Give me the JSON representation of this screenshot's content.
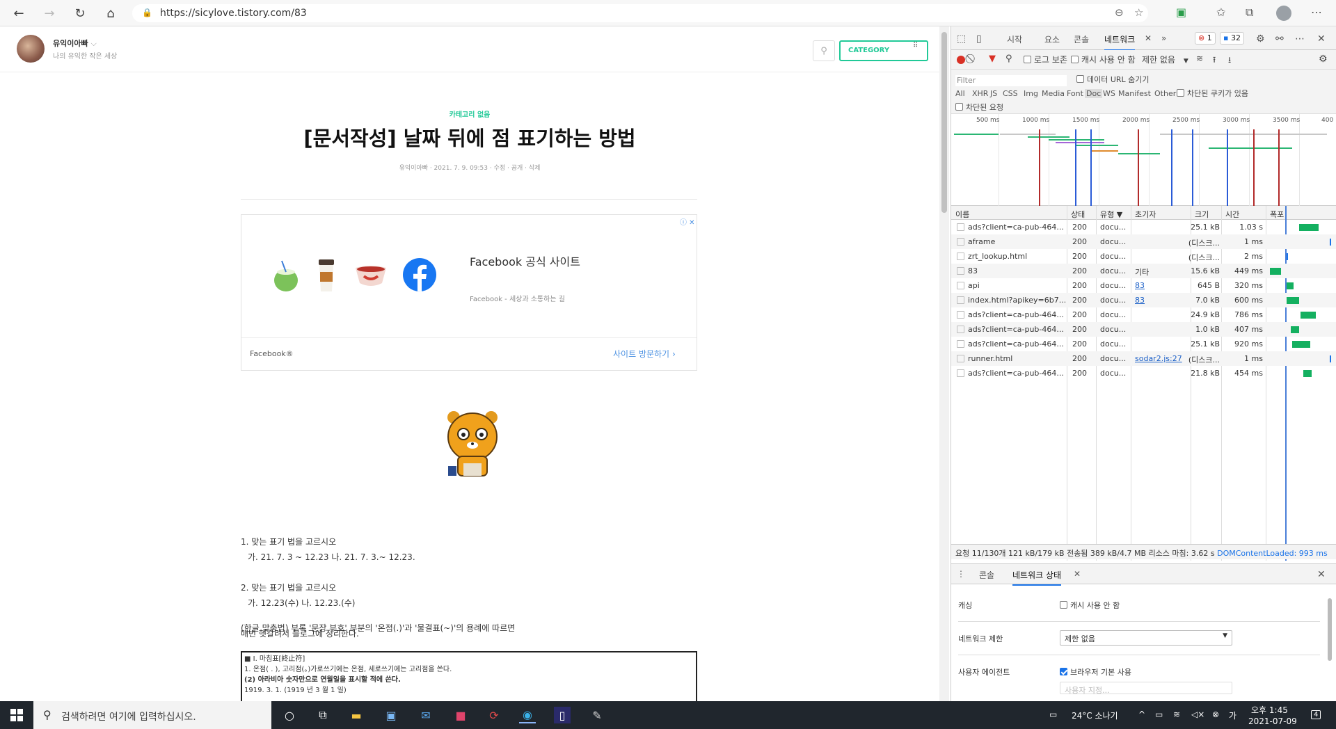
{
  "browser": {
    "url": "https://sicylove.tistory.com/83",
    "icons": [
      "back-icon",
      "forward-icon",
      "refresh-icon",
      "home-icon",
      "lock-icon",
      "zoom-out-icon",
      "star-add-icon",
      "extension-icon",
      "favorites-icon",
      "collections-icon",
      "profile-icon",
      "more-icon"
    ]
  },
  "blog": {
    "name": "유익이아빠",
    "description": "나의 유익한 작은 세상",
    "category_button": "CATEGORY"
  },
  "post": {
    "category": "카테고리 없음",
    "title": "[문서작성] 날짜 뒤에 점 표기하는 방법",
    "meta": "유익이아빠 · 2021. 7. 9. 09:53 · 수정 · 공개 · 삭제",
    "ad": {
      "title": "Facebook 공식 사이트",
      "description": "Facebook - 세상과 소통하는 길",
      "brand": "Facebook®",
      "cta": "사이트 방문하기"
    },
    "paragraphs": [
      "1. 맞는 표기 법을 고르시오",
      "가. 21. 7. 3 ~ 12.23    나. 21. 7. 3.~ 12.23.",
      "2. 맞는 표기 법을 고르시오",
      "가. 12.23(수)  나. 12.23.(수)",
      "매번 헷갈려서 블로그에 정리한다.",
      "(한글 맞춤법) 부록 '문장 부호' 부분의 '온점(.)'과 '물결표(~)'의 용례에 따르면"
    ],
    "quote_lines": [
      "■ Ⅰ. 마침표[終止符]",
      "1. 온점( . ), 고리점(。)가로쓰기에는 온점, 세로쓰기에는 고리점을 쓴다.",
      "(2) 아라비아 숫자만으로 연월일을 표시할 적에 쓴다.",
      "1919. 3. 1. (1919 년 3 월 1 일)"
    ]
  },
  "devtools": {
    "tabs": [
      "시작",
      "요소",
      "콘솔",
      "네트워크",
      "»"
    ],
    "active_tab": "네트워크",
    "error_count": "1",
    "message_count": "32",
    "toolbar": {
      "preserve_log": "로그 보존",
      "disable_cache": "캐시 사용 안 함",
      "throttle": "제한 없음"
    },
    "filter": {
      "placeholder": "Filter",
      "hide_data_urls": "데이터 URL 숨기기",
      "types": [
        "All",
        "XHR",
        "JS",
        "CSS",
        "Img",
        "Media",
        "Font",
        "Doc",
        "WS",
        "Manifest",
        "Other"
      ],
      "active_type": "Doc",
      "blocked_cookies": "차단된 쿠키가 있음",
      "blocked_requests": "차단된 요청"
    },
    "timeline_ticks": [
      "500 ms",
      "1000 ms",
      "1500 ms",
      "2000 ms",
      "2500 ms",
      "3000 ms",
      "3500 ms",
      "400"
    ],
    "columns": [
      "이름",
      "상태",
      "유형 ▼",
      "초기자",
      "크기",
      "시간",
      "폭포"
    ],
    "rows": [
      {
        "name": "ads?client=ca-pub-464...",
        "status": "200",
        "type": "docu...",
        "initiator": "",
        "initiator_link": false,
        "size": "25.1 kB",
        "time": "1.03 s"
      },
      {
        "name": "aframe",
        "status": "200",
        "type": "docu...",
        "initiator": "",
        "initiator_link": false,
        "size": "(디스크...",
        "time": "1 ms"
      },
      {
        "name": "zrt_lookup.html",
        "status": "200",
        "type": "docu...",
        "initiator": "",
        "initiator_link": false,
        "size": "(디스크...",
        "time": "2 ms"
      },
      {
        "name": "83",
        "status": "200",
        "type": "docu...",
        "initiator": "기타",
        "initiator_link": false,
        "size": "15.6 kB",
        "time": "449 ms"
      },
      {
        "name": "api",
        "status": "200",
        "type": "docu...",
        "initiator": "83",
        "initiator_link": true,
        "size": "645 B",
        "time": "320 ms"
      },
      {
        "name": "index.html?apikey=6b7...",
        "status": "200",
        "type": "docu...",
        "initiator": "83",
        "initiator_link": true,
        "size": "7.0 kB",
        "time": "600 ms"
      },
      {
        "name": "ads?client=ca-pub-464...",
        "status": "200",
        "type": "docu...",
        "initiator": "",
        "initiator_link": false,
        "size": "24.9 kB",
        "time": "786 ms"
      },
      {
        "name": "ads?client=ca-pub-464...",
        "status": "200",
        "type": "docu...",
        "initiator": "",
        "initiator_link": false,
        "size": "1.0 kB",
        "time": "407 ms"
      },
      {
        "name": "ads?client=ca-pub-464...",
        "status": "200",
        "type": "docu...",
        "initiator": "",
        "initiator_link": false,
        "size": "25.1 kB",
        "time": "920 ms"
      },
      {
        "name": "runner.html",
        "status": "200",
        "type": "docu...",
        "initiator": "sodar2.js:27",
        "initiator_link": true,
        "size": "(디스크...",
        "time": "1 ms"
      },
      {
        "name": "ads?client=ca-pub-464...",
        "status": "200",
        "type": "docu...",
        "initiator": "",
        "initiator_link": false,
        "size": "21.8 kB",
        "time": "454 ms"
      }
    ],
    "status_bar": "요청 11/130개  121 kB/179 kB 전송됨  389 kB/4.7 MB 리소스  마침: 3.62 s  ",
    "dom_content_loaded": "DOMContentLoaded: 993 ms",
    "drawer": {
      "tabs": [
        "콘솔",
        "네트워크 상태"
      ],
      "active_tab": "네트워크 상태",
      "cache_label": "캐싱",
      "cache_checkbox": "캐시 사용 안 함",
      "throttle_label": "네트워크 제한",
      "throttle_value": "제한 없음",
      "ua_label": "사용자 에이전트",
      "ua_checkbox": "브라우저 기본 사용",
      "ua_placeholder": "사용자 지정..."
    }
  },
  "taskbar": {
    "search_placeholder": "검색하려면 여기에 입력하십시오.",
    "weather": "24°C 소나기",
    "time": "오후 1:45",
    "date": "2021-07-09",
    "notification_count": "4"
  }
}
